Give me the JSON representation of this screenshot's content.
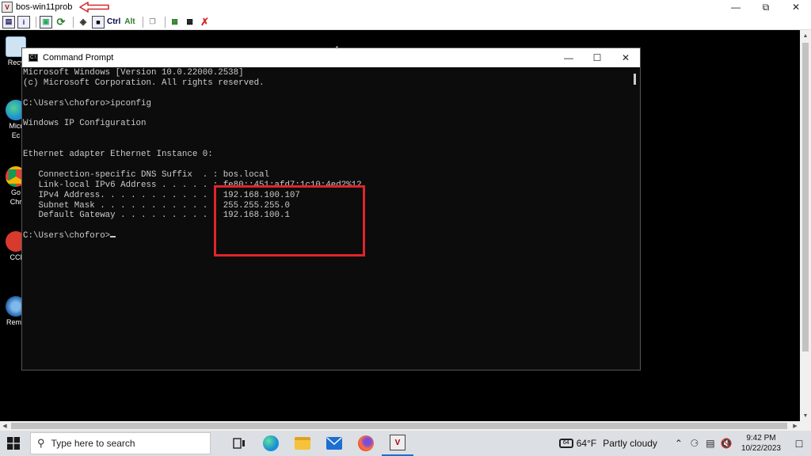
{
  "vnc": {
    "title": "bos-win11prob",
    "toolbar_ctrl": "Ctrl",
    "toolbar_alt": "Alt"
  },
  "cmd": {
    "title": "Command Prompt",
    "lines": [
      "Microsoft Windows [Version 10.0.22000.2538]",
      "(c) Microsoft Corporation. All rights reserved.",
      "",
      "C:\\Users\\choforo>ipconfig",
      "",
      "Windows IP Configuration",
      "",
      "",
      "Ethernet adapter Ethernet Instance 0:",
      "",
      "   Connection-specific DNS Suffix  . : bos.local",
      "   Link-local IPv6 Address . . . . . : fe80::451:afd7:1c10:4ed2%12",
      "   IPv4 Address. . . . . . . . . . . : 192.168.100.107",
      "   Subnet Mask . . . . . . . . . . . : 255.255.255.0",
      "   Default Gateway . . . . . . . . . : 192.168.100.1",
      "",
      "C:\\Users\\choforo>"
    ]
  },
  "desktop_icons": [
    {
      "label": "Recy",
      "icon": "recycle-bin-icon",
      "color": "#9ec9e8"
    },
    {
      "label": "Micr",
      "label2": "Ec",
      "icon": "edge-icon",
      "color": "#1b8fd6"
    },
    {
      "label": "Go",
      "label2": "Chr",
      "icon": "chrome-icon",
      "color": "#2fa84f"
    },
    {
      "label": "CCl",
      "icon": "ccleaner-icon",
      "color": "#d83a2e"
    },
    {
      "label": "Remo",
      "icon": "remote-desktop-icon",
      "color": "#1f5fa8"
    }
  ],
  "taskbar": {
    "search_placeholder": "Type here to search",
    "weather_temp": "64°F",
    "weather_desc": "Partly cloudy",
    "time": "9:42 PM",
    "date": "10/22/2023"
  },
  "colors": {
    "highlight": "#e0242b",
    "console_bg": "#0c0c0c",
    "console_fg": "#cccccc"
  }
}
